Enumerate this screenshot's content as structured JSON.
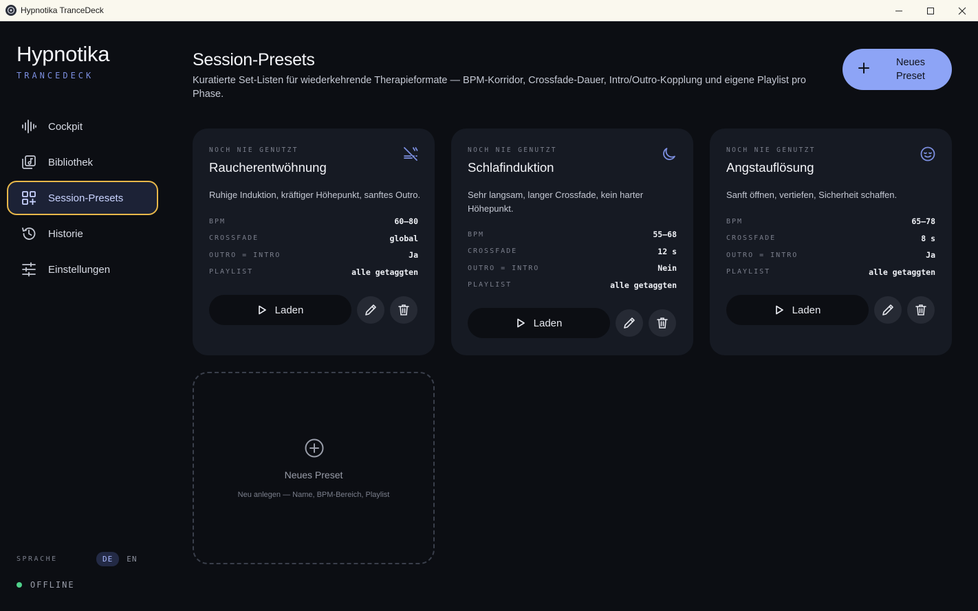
{
  "window": {
    "title": "Hypnotika TranceDeck"
  },
  "sidebar": {
    "brand_name": "Hypnotika",
    "brand_sub": "TRANCEDECK",
    "items": [
      {
        "label": "Cockpit",
        "icon": "waveform-icon"
      },
      {
        "label": "Bibliothek",
        "icon": "library-icon"
      },
      {
        "label": "Session-Presets",
        "icon": "grid-add-icon",
        "active": true
      },
      {
        "label": "Historie",
        "icon": "history-icon"
      },
      {
        "label": "Einstellungen",
        "icon": "sliders-icon"
      }
    ],
    "language_label": "SPRACHE",
    "languages": [
      "DE",
      "EN"
    ],
    "active_language": "DE",
    "status": "OFFLINE"
  },
  "main": {
    "title": "Session-Presets",
    "description": "Kuratierte Set-Listen für wiederkehrende Therapieformate — BPM-Korridor, Crossfade-Dauer, Intro/Outro-Kopplung und eigene Playlist pro Phase.",
    "new_preset_button": "Neues Preset",
    "presets": [
      {
        "meta": "NOCH NIE GENUTZT",
        "title": "Raucherentwöhnung",
        "icon": "no-smoking-icon",
        "description": "Ruhige Induktion, kräftiger Höhepunkt, sanftes Outro.",
        "stats": [
          {
            "key": "BPM",
            "value": "60–80"
          },
          {
            "key": "CROSSFADE",
            "value": "global"
          },
          {
            "key": "OUTRO = INTRO",
            "value": "Ja"
          },
          {
            "key": "PLAYLIST",
            "value": "alle getaggten"
          }
        ],
        "load_label": "Laden"
      },
      {
        "meta": "NOCH NIE GENUTZT",
        "title": "Schlafinduktion",
        "icon": "moon-icon",
        "description": "Sehr langsam, langer Crossfade, kein harter Höhepunkt.",
        "stats": [
          {
            "key": "BPM",
            "value": "55–68"
          },
          {
            "key": "CROSSFADE",
            "value": "12 s"
          },
          {
            "key": "OUTRO = INTRO",
            "value": "Nein"
          },
          {
            "key": "PLAYLIST",
            "value": "alle getaggten"
          }
        ],
        "load_label": "Laden"
      },
      {
        "meta": "NOCH NIE GENUTZT",
        "title": "Angstauflösung",
        "icon": "calm-face-icon",
        "description": "Sanft öffnen, vertiefen, Sicherheit schaffen.",
        "stats": [
          {
            "key": "BPM",
            "value": "65–78"
          },
          {
            "key": "CROSSFADE",
            "value": "8 s"
          },
          {
            "key": "OUTRO = INTRO",
            "value": "Ja"
          },
          {
            "key": "PLAYLIST",
            "value": "alle getaggten"
          }
        ],
        "load_label": "Laden"
      }
    ],
    "add_card": {
      "title": "Neues Preset",
      "description": "Neu anlegen — Name, BPM-Bereich, Playlist"
    }
  },
  "colors": {
    "background": "#0c0e13",
    "card": "#161a23",
    "accent": "#8da4f6",
    "active_border": "#e8b84a",
    "status_online": "#4fd08a"
  }
}
